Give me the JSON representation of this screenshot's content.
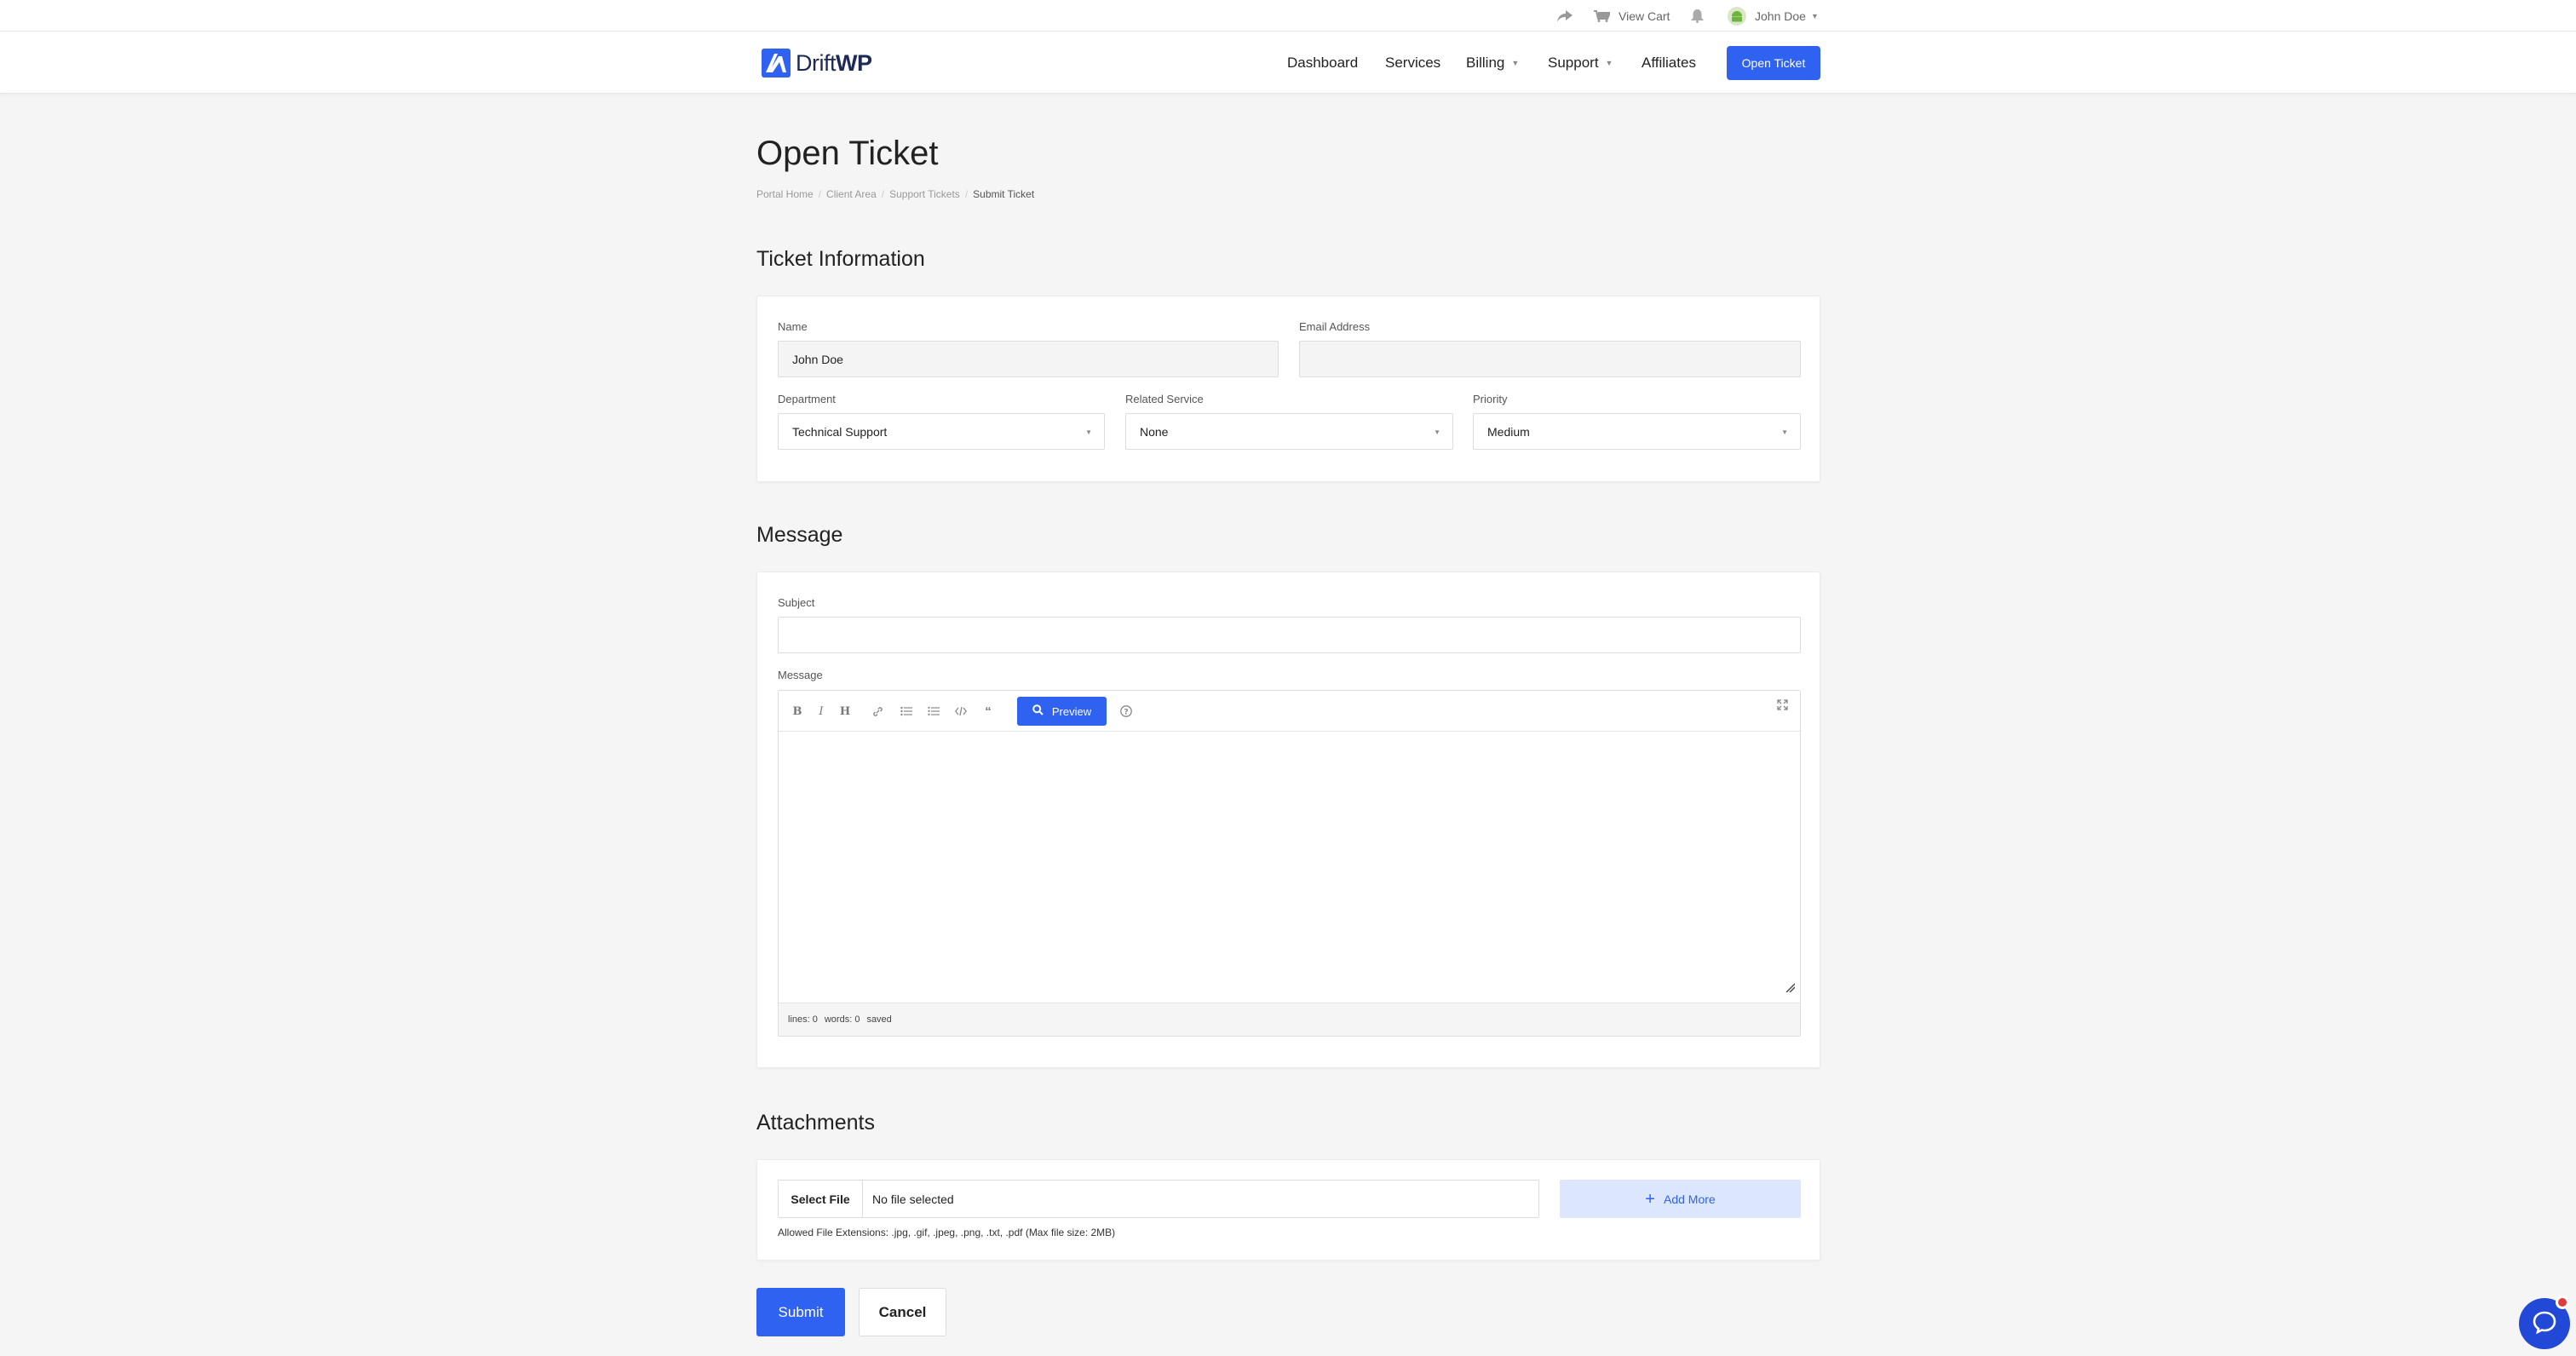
{
  "colors": {
    "accent": "#2f62f0",
    "accent_light": "#dce6fd",
    "background": "#f5f5f5"
  },
  "topbar": {
    "share_icon": "share-icon",
    "cart_label": "View Cart",
    "cart_icon": "cart-icon",
    "notifications_icon": "bell-icon",
    "user_name": "John Doe",
    "user_avatar_icon": "android-avatar-icon"
  },
  "brand": {
    "name_light": "Drift",
    "name_bold": "WP"
  },
  "nav": {
    "items": [
      "Dashboard",
      "Services",
      "Billing",
      "Support",
      "Affiliates"
    ],
    "cta": "Open Ticket"
  },
  "page": {
    "title": "Open Ticket",
    "breadcrumb": [
      "Portal Home",
      "Client Area",
      "Support Tickets",
      "Submit Ticket"
    ]
  },
  "ticket_info": {
    "heading": "Ticket Information",
    "name_label": "Name",
    "name_value": "John Doe",
    "email_label": "Email Address",
    "email_value": "",
    "department_label": "Department",
    "department_value": "Technical Support",
    "service_label": "Related Service",
    "service_value": "None",
    "priority_label": "Priority",
    "priority_value": "Medium"
  },
  "message": {
    "heading": "Message",
    "subject_label": "Subject",
    "subject_value": "",
    "message_label": "Message",
    "toolbar": [
      "bold-icon",
      "italic-icon",
      "heading-icon",
      "link-icon",
      "unordered-list-icon",
      "ordered-list-icon",
      "code-icon",
      "quote-icon",
      "help-icon",
      "fullscreen-icon"
    ],
    "preview_label": "Preview",
    "status_lines": "lines: 0",
    "status_words": "words: 0",
    "status_saved": "saved"
  },
  "attachments": {
    "heading": "Attachments",
    "select_file": "Select File",
    "no_file": "No file selected",
    "add_more": "Add More",
    "allowed": "Allowed File Extensions: .jpg, .gif, .jpeg, .png, .txt, .pdf (Max file size: 2MB)"
  },
  "actions": {
    "submit": "Submit",
    "cancel": "Cancel"
  },
  "chat": {
    "icon": "chat-bubble-icon"
  }
}
